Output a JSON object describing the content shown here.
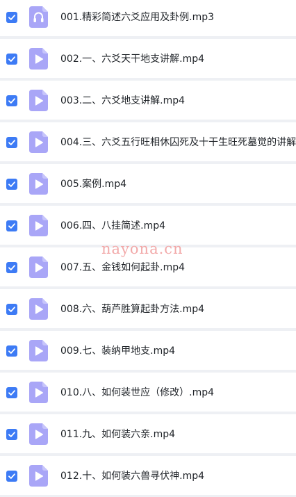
{
  "accent_color": "#3d7bf5",
  "icon_color": "#a9a6f7",
  "files": [
    {
      "name": "001.精彩简述六爻应用及卦例.mp3",
      "icon": "audio-file-icon",
      "checked": true
    },
    {
      "name": "002.一、六爻天干地支讲解.mp4",
      "icon": "video-file-icon",
      "checked": true
    },
    {
      "name": "003.二、六爻地支讲解.mp4",
      "icon": "video-file-icon",
      "checked": true
    },
    {
      "name": "004.三、六爻五行旺相休囚死及十干生旺死墓觉的讲解.",
      "icon": "video-file-icon",
      "checked": true
    },
    {
      "name": "005.案例.mp4",
      "icon": "video-file-icon",
      "checked": true
    },
    {
      "name": "006.四、八挂简述.mp4",
      "icon": "video-file-icon",
      "checked": true
    },
    {
      "name": "007.五、金钱如何起卦.mp4",
      "icon": "video-file-icon",
      "checked": true
    },
    {
      "name": "008.六、葫芦胜算起卦方法.mp4",
      "icon": "video-file-icon",
      "checked": true
    },
    {
      "name": "009.七、装纳甲地支.mp4",
      "icon": "video-file-icon",
      "checked": true
    },
    {
      "name": "010.八、如何装世应（修改）.mp4",
      "icon": "video-file-icon",
      "checked": true
    },
    {
      "name": "011.九、如何装六亲.mp4",
      "icon": "video-file-icon",
      "checked": true
    },
    {
      "name": "012.十、如何装六兽寻伏神.mp4",
      "icon": "video-file-icon",
      "checked": true
    }
  ],
  "watermark": "nayona.cn"
}
